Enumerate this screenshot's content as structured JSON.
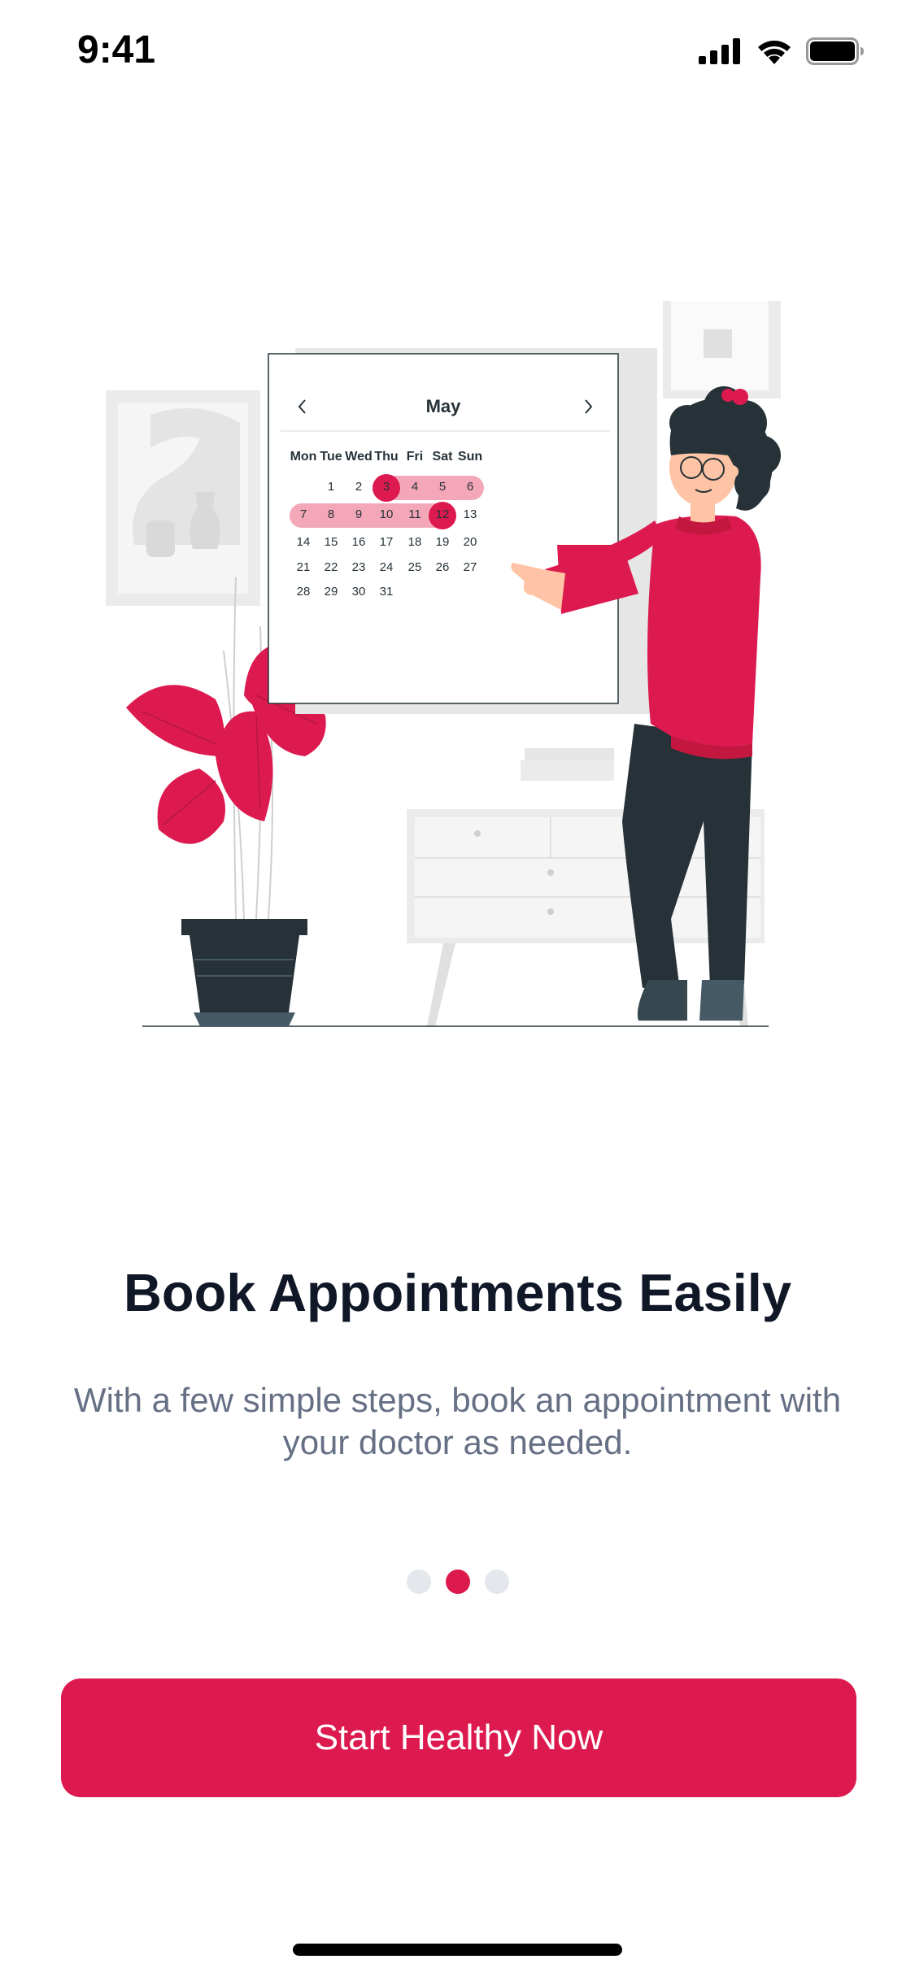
{
  "status_bar": {
    "time": "9:41",
    "icons": [
      "cellular-signal-icon",
      "wifi-icon",
      "battery-icon"
    ]
  },
  "illustration": {
    "calendar": {
      "month": "May",
      "prev_icon": "chevron-left-icon",
      "next_icon": "chevron-right-icon",
      "weekdays": [
        "Mon",
        "Tue",
        "Wed",
        "Thu",
        "Fri",
        "Sat",
        "Sun"
      ],
      "weeks": [
        [
          "",
          "1",
          "2",
          "3",
          "4",
          "5",
          "6"
        ],
        [
          "7",
          "8",
          "9",
          "10",
          "11",
          "12",
          "13"
        ],
        [
          "14",
          "15",
          "16",
          "17",
          "18",
          "19",
          "20"
        ],
        [
          "21",
          "22",
          "23",
          "24",
          "25",
          "26",
          "27"
        ],
        [
          "28",
          "29",
          "30",
          "31",
          "",
          "",
          ""
        ]
      ],
      "range_start": "3",
      "range_end": "12"
    }
  },
  "onboarding": {
    "title": "Book Appointments Easily",
    "subtitle": "With a few simple steps, book an appointment with your doctor as needed.",
    "page_count": 3,
    "active_page": 2
  },
  "cta": {
    "label": "Start Healthy Now"
  },
  "colors": {
    "accent": "#dd1a4f",
    "range_fill": "#f4a7b9",
    "title": "#101828",
    "subtitle": "#667085",
    "dot_inactive": "#e4e7ec"
  }
}
